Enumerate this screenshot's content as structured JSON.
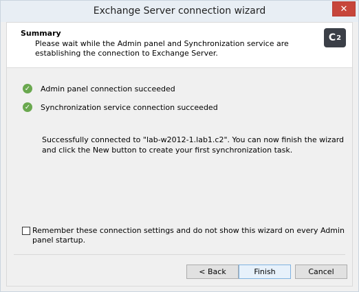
{
  "window": {
    "title": "Exchange Server connection wizard",
    "close_label": "✕"
  },
  "header": {
    "title": "Summary",
    "subtitle": "Please wait while the Admin panel and Synchronization service are establishing the connection to Exchange Server.",
    "logo_text": "C",
    "logo_sup": "2"
  },
  "statuses": [
    {
      "label": "Admin panel connection succeeded",
      "icon": "check-circle-icon"
    },
    {
      "label": "Synchronization service connection succeeded",
      "icon": "check-circle-icon"
    }
  ],
  "message": "Successfully connected to \"lab-w2012-1.lab1.c2\". You can now finish the wizard and click the New button to create your first synchronization task.",
  "remember": {
    "label": "Remember these connection settings and do not show this wizard on every Admin panel startup.",
    "checked": false
  },
  "buttons": {
    "back": "< Back",
    "finish": "Finish",
    "cancel": "Cancel"
  },
  "colors": {
    "success": "#6aa84f",
    "close": "#c7463b",
    "logo_bg": "#3b3f47"
  }
}
